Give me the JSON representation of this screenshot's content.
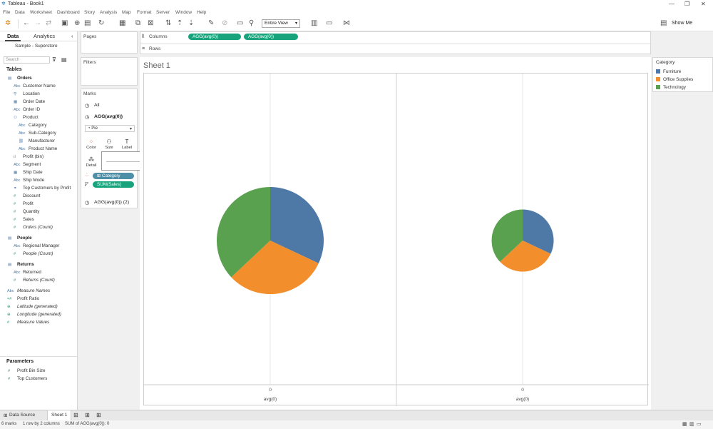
{
  "window": {
    "title": "Tableau - Book1"
  },
  "menu": [
    "File",
    "Data",
    "Worksheet",
    "Dashboard",
    "Story",
    "Analysis",
    "Map",
    "Format",
    "Server",
    "Window",
    "Help"
  ],
  "toolbar": {
    "view_mode": "Entire View",
    "show_me": "Show Me"
  },
  "data_pane": {
    "tab_data": "Data",
    "tab_analytics": "Analytics",
    "source": "Sample - Superstore",
    "search_placeholder": "Search",
    "tables_header": "Tables",
    "rows": [
      {
        "label": "Orders",
        "type": "section"
      },
      {
        "label": "Customer Name",
        "type": "abc"
      },
      {
        "label": "Location",
        "type": "geo"
      },
      {
        "label": "Order Date",
        "type": "date"
      },
      {
        "label": "Order ID",
        "type": "abc"
      },
      {
        "label": "Product",
        "type": "hier"
      },
      {
        "label": "Category",
        "type": "abc",
        "indent": true
      },
      {
        "label": "Sub-Category",
        "type": "abc",
        "indent": true
      },
      {
        "label": "Manufacturer",
        "type": "link",
        "indent": true
      },
      {
        "label": "Product Name",
        "type": "abc",
        "indent": true
      },
      {
        "label": "Profit (bin)",
        "type": "bin"
      },
      {
        "label": "Segment",
        "type": "abc"
      },
      {
        "label": "Ship Date",
        "type": "date"
      },
      {
        "label": "Ship Mode",
        "type": "abc"
      },
      {
        "label": "Top Customers by Profit",
        "type": "set"
      },
      {
        "label": "Discount",
        "type": "measure"
      },
      {
        "label": "Profit",
        "type": "measure"
      },
      {
        "label": "Quantity",
        "type": "measure"
      },
      {
        "label": "Sales",
        "type": "measure"
      },
      {
        "label": "Orders (Count)",
        "type": "measure",
        "italic": true
      },
      {
        "label": "People",
        "type": "section"
      },
      {
        "label": "Regional Manager",
        "type": "abc"
      },
      {
        "label": "People (Count)",
        "type": "measure",
        "italic": true
      },
      {
        "label": "Returns",
        "type": "section"
      },
      {
        "label": "Returned",
        "type": "abc"
      },
      {
        "label": "Returns (Count)",
        "type": "measure",
        "italic": true
      },
      {
        "label": "Measure Names",
        "type": "abc",
        "italic": true,
        "top": true
      },
      {
        "label": "Profit Ratio",
        "type": "calc",
        "top": true
      },
      {
        "label": "Latitude (generated)",
        "type": "globe",
        "italic": true,
        "top": true
      },
      {
        "label": "Longitude (generated)",
        "type": "globe",
        "italic": true,
        "top": true
      },
      {
        "label": "Measure Values",
        "type": "measure",
        "italic": true,
        "top": true
      }
    ],
    "parameters_header": "Parameters",
    "parameters": [
      "Profit Bin Size",
      "Top Customers"
    ]
  },
  "cards": {
    "pages": "Pages",
    "filters": "Filters",
    "marks": "Marks",
    "marks_all": "All",
    "marks_agg1": "AGG(avg(0))",
    "marks_type": "Pie",
    "btn_color": "Color",
    "btn_size": "Size",
    "btn_label": "Label",
    "btn_detail": "Detail",
    "pill_category": "Category",
    "pill_sales": "SUM(Sales)",
    "marks_agg2": "AGG(avg(0)) (2)"
  },
  "shelves": {
    "columns_label": "Columns",
    "rows_label": "Rows",
    "column_pills": [
      "AGG(avg(0))",
      "AGG(avg(0))"
    ]
  },
  "sheet": {
    "title": "Sheet 1"
  },
  "chart_data": [
    {
      "type": "pie",
      "categories": [
        "Furniture",
        "Office Supplies",
        "Technology"
      ],
      "values": [
        0.32,
        0.31,
        0.37
      ],
      "xlabel": "avg(0)",
      "x_tick": "0",
      "size_relative": 1.0
    },
    {
      "type": "pie",
      "categories": [
        "Furniture",
        "Office Supplies",
        "Technology"
      ],
      "values": [
        0.32,
        0.31,
        0.37
      ],
      "xlabel": "avg(0)",
      "x_tick": "0",
      "size_relative": 0.58
    }
  ],
  "legend": {
    "title": "Category",
    "items": [
      {
        "label": "Furniture",
        "color": "#4e79a7"
      },
      {
        "label": "Office Supplies",
        "color": "#f28e2b"
      },
      {
        "label": "Technology",
        "color": "#59a14f"
      }
    ]
  },
  "sheet_tabs": {
    "data_source": "Data Source",
    "sheet1": "Sheet 1"
  },
  "status": {
    "marks": "6 marks",
    "rows_cols": "1 row by 2 columns",
    "sum": "SUM of AGG(avg(0)): 0"
  }
}
